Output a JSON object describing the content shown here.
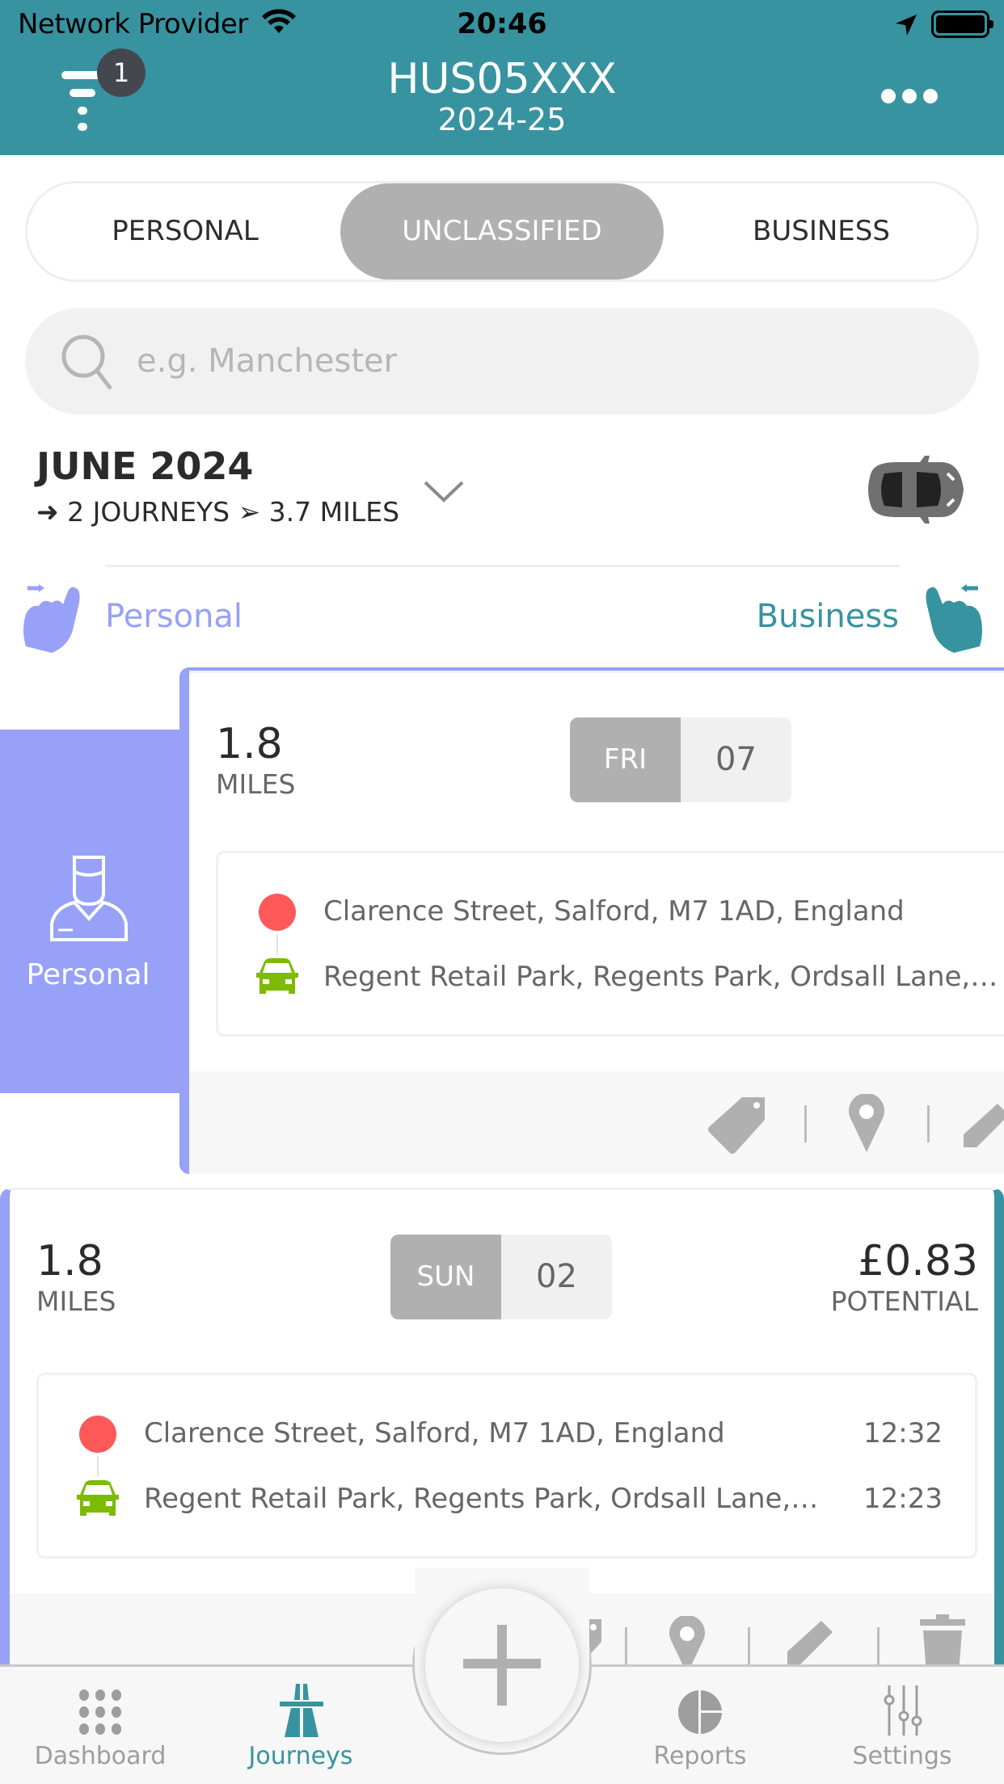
{
  "status_bar": {
    "carrier": "Network Provider",
    "time": "20:46"
  },
  "header": {
    "title": "HUS05XXX",
    "subtitle": "2024-25",
    "filter_badge": "1",
    "more_icon": "ellipsis-icon",
    "colors": {
      "header_bg": "#3793a0"
    }
  },
  "segments": {
    "items": [
      {
        "label": "PERSONAL",
        "active": false
      },
      {
        "label": "UNCLASSIFIED",
        "active": true
      },
      {
        "label": "BUSINESS",
        "active": false
      }
    ]
  },
  "search": {
    "placeholder": "e.g. Manchester",
    "value": ""
  },
  "month": {
    "title": "JUNE 2024",
    "summary": "➜ 2 JOURNEYS ➢ 3.7 MILES"
  },
  "swipe_hint": {
    "personal_label": "Personal",
    "business_label": "Business",
    "colors": {
      "personal": "#97a1f7",
      "business": "#3793a0"
    }
  },
  "journeys": [
    {
      "miles": "1.8",
      "miles_label": "MILES",
      "day_of_week": "FRI",
      "day": "07",
      "reveal_label": "Personal",
      "start_address": "Clarence Street, Salford, M7 1AD, England",
      "end_address": "Regent Retail Park, Regents Park, Ordsall Lane,…",
      "start_time": "",
      "end_time": ""
    },
    {
      "miles": "1.8",
      "miles_label": "MILES",
      "day_of_week": "SUN",
      "day": "02",
      "amount": "£0.83",
      "amount_label": "POTENTIAL",
      "start_address": "Clarence Street, Salford, M7 1AD, England",
      "end_address": "Regent Retail Park, Regents Park, Ordsall Lane,…",
      "start_time": "12:32",
      "end_time": "12:23"
    }
  ],
  "tabbar": {
    "items": [
      {
        "label": "Dashboard",
        "icon": "dashboard-grid-icon",
        "active": false
      },
      {
        "label": "Journeys",
        "icon": "motorway-road-icon",
        "active": true
      },
      {
        "label": "Reports",
        "icon": "pie-chart-icon",
        "active": false
      },
      {
        "label": "Settings",
        "icon": "sliders-icon",
        "active": false
      }
    ],
    "fab_icon": "plus-icon"
  }
}
